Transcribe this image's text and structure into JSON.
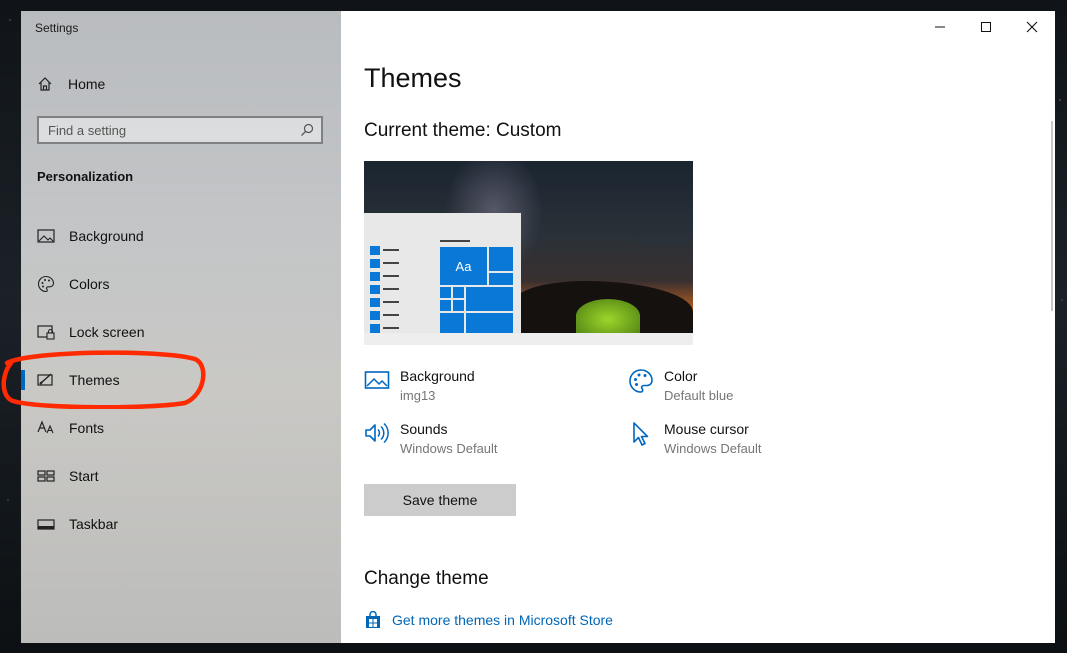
{
  "window": {
    "title": "Settings"
  },
  "sidebar": {
    "home_label": "Home",
    "search_placeholder": "Find a setting",
    "section_title": "Personalization",
    "items": [
      {
        "label": "Background",
        "icon": "picture-icon"
      },
      {
        "label": "Colors",
        "icon": "palette-icon"
      },
      {
        "label": "Lock screen",
        "icon": "lock-screen-icon"
      },
      {
        "label": "Themes",
        "icon": "themes-icon",
        "selected": true
      },
      {
        "label": "Fonts",
        "icon": "fonts-icon"
      },
      {
        "label": "Start",
        "icon": "start-icon"
      },
      {
        "label": "Taskbar",
        "icon": "taskbar-icon"
      }
    ]
  },
  "main": {
    "page_title": "Themes",
    "current_theme": "Current theme: Custom",
    "preview": {
      "sample_text": "Aa"
    },
    "properties": [
      {
        "name": "Background",
        "value": "img13",
        "icon": "picture-icon"
      },
      {
        "name": "Color",
        "value": "Default blue",
        "icon": "palette-icon"
      },
      {
        "name": "Sounds",
        "value": "Windows Default",
        "icon": "speaker-icon"
      },
      {
        "name": "Mouse cursor",
        "value": "Windows Default",
        "icon": "cursor-icon"
      }
    ],
    "save_button": "Save theme",
    "change_theme_title": "Change theme",
    "store_link": "Get more themes in Microsoft Store"
  },
  "colors": {
    "accent": "#0067c0",
    "annotation": "#ff2a00",
    "tile_blue": "#0a78d6"
  }
}
